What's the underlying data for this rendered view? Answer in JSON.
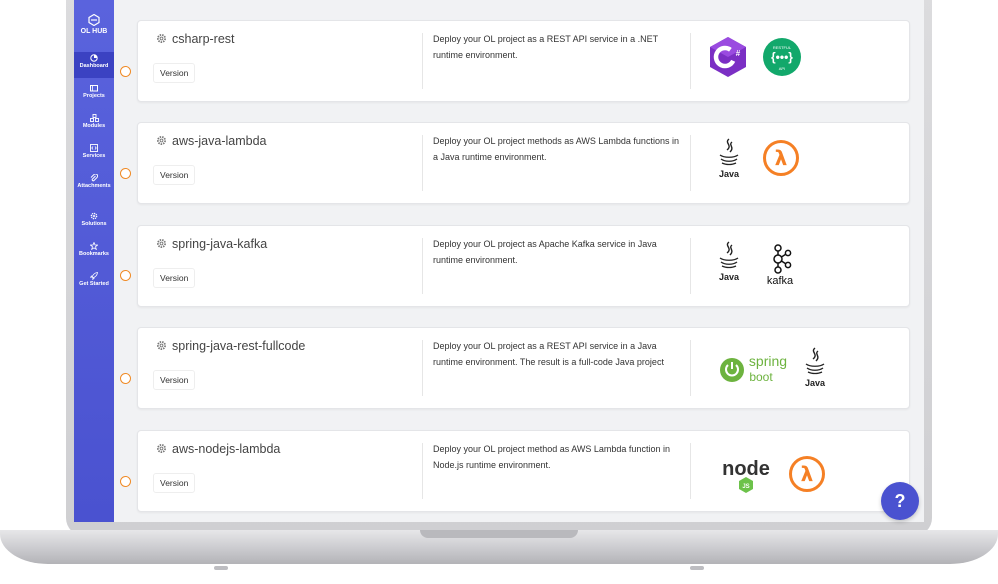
{
  "sidebar": {
    "brand": "OL HUB",
    "items": [
      {
        "label": "Dashboard",
        "icon": "dashboard-icon",
        "active": true
      },
      {
        "label": "Projects",
        "icon": "folder-icon"
      },
      {
        "label": "Modules",
        "icon": "modules-icon"
      },
      {
        "label": "Services",
        "icon": "code-icon"
      },
      {
        "label": "Attachments",
        "icon": "paperclip-icon"
      },
      {
        "label": "Solutions",
        "icon": "gear-icon"
      },
      {
        "label": "Bookmarks",
        "icon": "star-icon"
      },
      {
        "label": "Get Started",
        "icon": "rocket-icon"
      }
    ]
  },
  "version_label": "Version",
  "cards": [
    {
      "title": "csharp-rest",
      "description": "Deploy your OL project as a REST API service in a .NET runtime environment.",
      "logos": [
        "csharp-logo",
        "restful-api-logo"
      ]
    },
    {
      "title": "aws-java-lambda",
      "description": "Deploy your OL project methods as AWS Lambda functions in a Java runtime environment.",
      "logos": [
        "java-logo",
        "aws-lambda-logo"
      ]
    },
    {
      "title": "spring-java-kafka",
      "description": "Deploy your OL project as Apache Kafka service in Java runtime environment.",
      "logos": [
        "java-logo",
        "kafka-logo"
      ]
    },
    {
      "title": "spring-java-rest-fullcode",
      "description": "Deploy your OL project as a REST API service in a Java runtime environment. The result is a full-code Java project",
      "logos": [
        "spring-boot-logo",
        "java-logo"
      ]
    },
    {
      "title": "aws-nodejs-lambda",
      "description": "Deploy your OL project method as AWS Lambda function in Node.js runtime environment.",
      "logos": [
        "nodejs-logo",
        "aws-lambda-logo"
      ]
    }
  ],
  "logo_text": {
    "csharp": "C#",
    "restful": "RESTFUL",
    "api": "API",
    "java": "Java",
    "lambda": "λ",
    "kafka": "kafka",
    "spring": "spring",
    "boot": "boot",
    "node": "node",
    "js": "JS"
  },
  "help_label": "?",
  "colors": {
    "sidebar": "#4a52d0",
    "radio": "#f08a24",
    "lambda": "#f58025",
    "csharp": "#7b2fc4",
    "restful": "#12a86b",
    "spring": "#6db33f"
  }
}
